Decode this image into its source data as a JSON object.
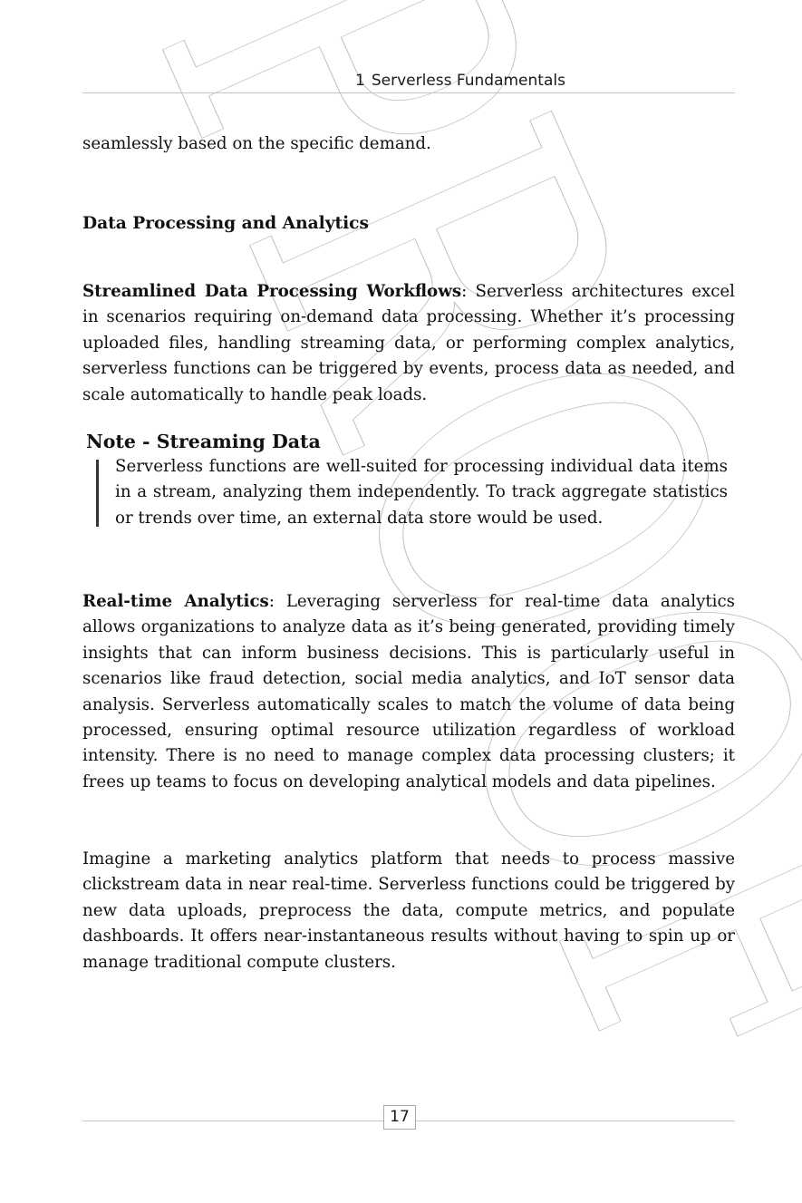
{
  "header": {
    "chapter_number": "1",
    "chapter_title": "Serverless Fundamentals"
  },
  "watermark": {
    "text": "PROOF",
    "color": "#bdbdbd"
  },
  "content": {
    "continuation": "seamlessly based on the specific demand.",
    "section_heading": "Data Processing and Analytics",
    "p1": {
      "term": "Streamlined Data Processing Workflows",
      "text": ": Serverless architectures excel in scenarios requiring on-demand data processing. Whether it’s processing uploaded files, handling streaming data, or performing complex analytics, serverless functions can be triggered by events, process data as needed, and scale automatically to handle peak loads."
    },
    "note": {
      "title": "Note - Streaming Data",
      "body": "Serverless functions are well-suited for processing individual data items in a stream, analyzing them independently. To track aggregate statistics or trends over time, an external data store would be used."
    },
    "p2": {
      "term": "Real-time Analytics",
      "text": ": Leveraging serverless for real-time data analytics allows organizations to analyze data as it’s being generated, providing timely insights that can inform business decisions. This is particularly useful in scenarios like fraud detection, social media analytics, and IoT sensor data analysis. Serverless automatically scales to match the volume of data being processed, ensuring optimal resource utilization regardless of workload intensity. There is no need to manage complex data processing clusters; it frees up teams to focus on developing analytical models and data pipelines."
    },
    "p3": "Imagine a marketing analytics platform that needs to process massive clickstream data in near real-time. Serverless functions could be triggered by new data uploads, preprocess the data, compute metrics, and populate dashboards. It offers near-instantaneous results without having to spin up or manage traditional compute clusters."
  },
  "footer": {
    "page_number": "17"
  }
}
